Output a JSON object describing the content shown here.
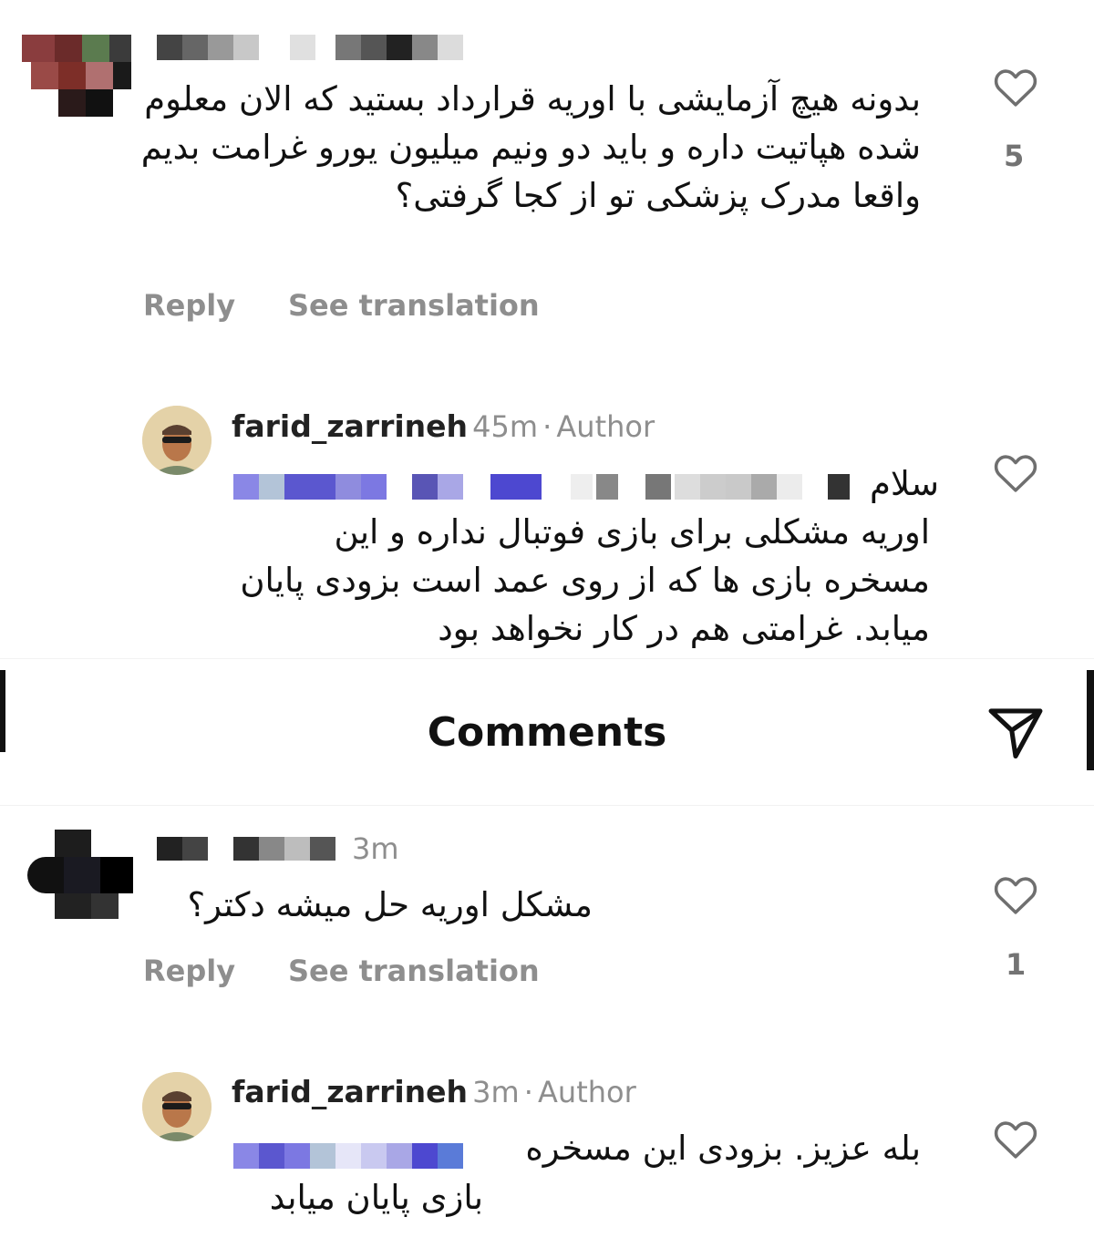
{
  "header": {
    "title": "Comments"
  },
  "comments": [
    {
      "text": "بدونه هیچ آزمایشی با اوریه قرارداد بستید که الان معلوم شده هپاتیت داره و باید دو ونیم میلیون یورو غرامت بدیم واقعا مدرک پزشکی تو از کجا گرفتی؟",
      "reply_label": "Reply",
      "translate_label": "See translation",
      "likes": "5",
      "reply": {
        "username": "farid_zarrineh",
        "time": "45m",
        "sep": "·",
        "badge": "Author",
        "text_line1": "سلام",
        "text_rest": "اوریه مشکلی برای بازی فوتبال نداره و این مسخره بازی ها که از روی عمد است بزودی پایان میابد. غرامتی هم در کار نخواهد بود"
      }
    },
    {
      "time": "3m",
      "text": "مشکل اوریه حل میشه دکتر؟",
      "reply_label": "Reply",
      "translate_label": "See translation",
      "likes": "1",
      "reply": {
        "username": "farid_zarrineh",
        "time": "3m",
        "sep": "·",
        "badge": "Author",
        "text_line1": "بله عزیز. بزودی این مسخره",
        "text_rest": "بازی پایان میابد"
      }
    }
  ],
  "icons": {
    "like": "heart-icon",
    "share": "send-icon"
  },
  "colors": {
    "text": "#111111",
    "muted": "#8e8e8e",
    "redaction_blue": "#6a66d8"
  }
}
